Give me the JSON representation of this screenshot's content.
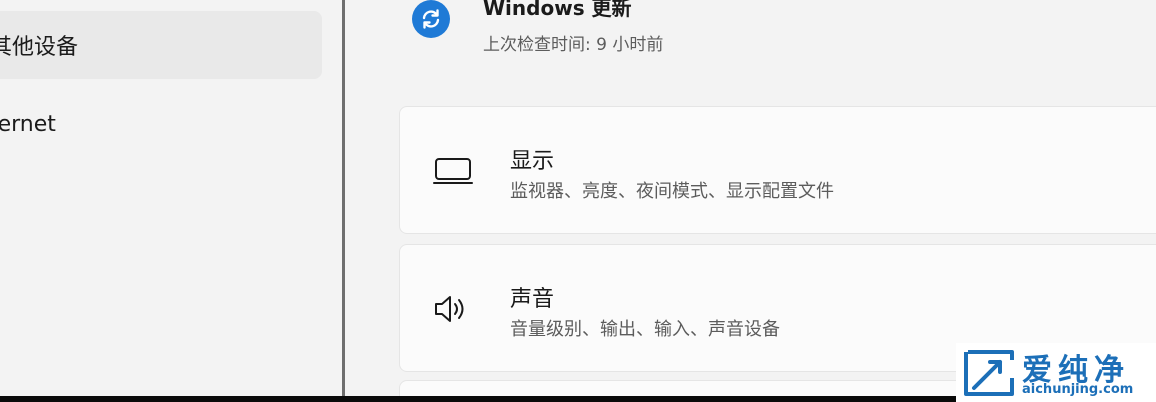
{
  "sidebar": {
    "items": [
      {
        "label": "蓝牙和其他设备",
        "visible_label": "其他设备",
        "selected": true
      },
      {
        "label": "网络和 Internet",
        "visible_label": "nternet",
        "selected": false
      }
    ]
  },
  "update": {
    "title": "Windows 更新",
    "subtitle": "上次检查时间: 9 小时前",
    "icon": "refresh-icon"
  },
  "cards": [
    {
      "title": "显示",
      "desc": "监视器、亮度、夜间模式、显示配置文件",
      "icon": "display-icon"
    },
    {
      "title": "声音",
      "desc": "音量级别、输出、输入、声音设备",
      "icon": "speaker-icon"
    }
  ],
  "watermark": {
    "name": "爱纯净",
    "url": "aichunjing.com"
  },
  "colors": {
    "accent": "#1f7ad6",
    "watermark": "#1c6fb8",
    "background": "#f3f3f3",
    "card": "#fbfbfb"
  }
}
